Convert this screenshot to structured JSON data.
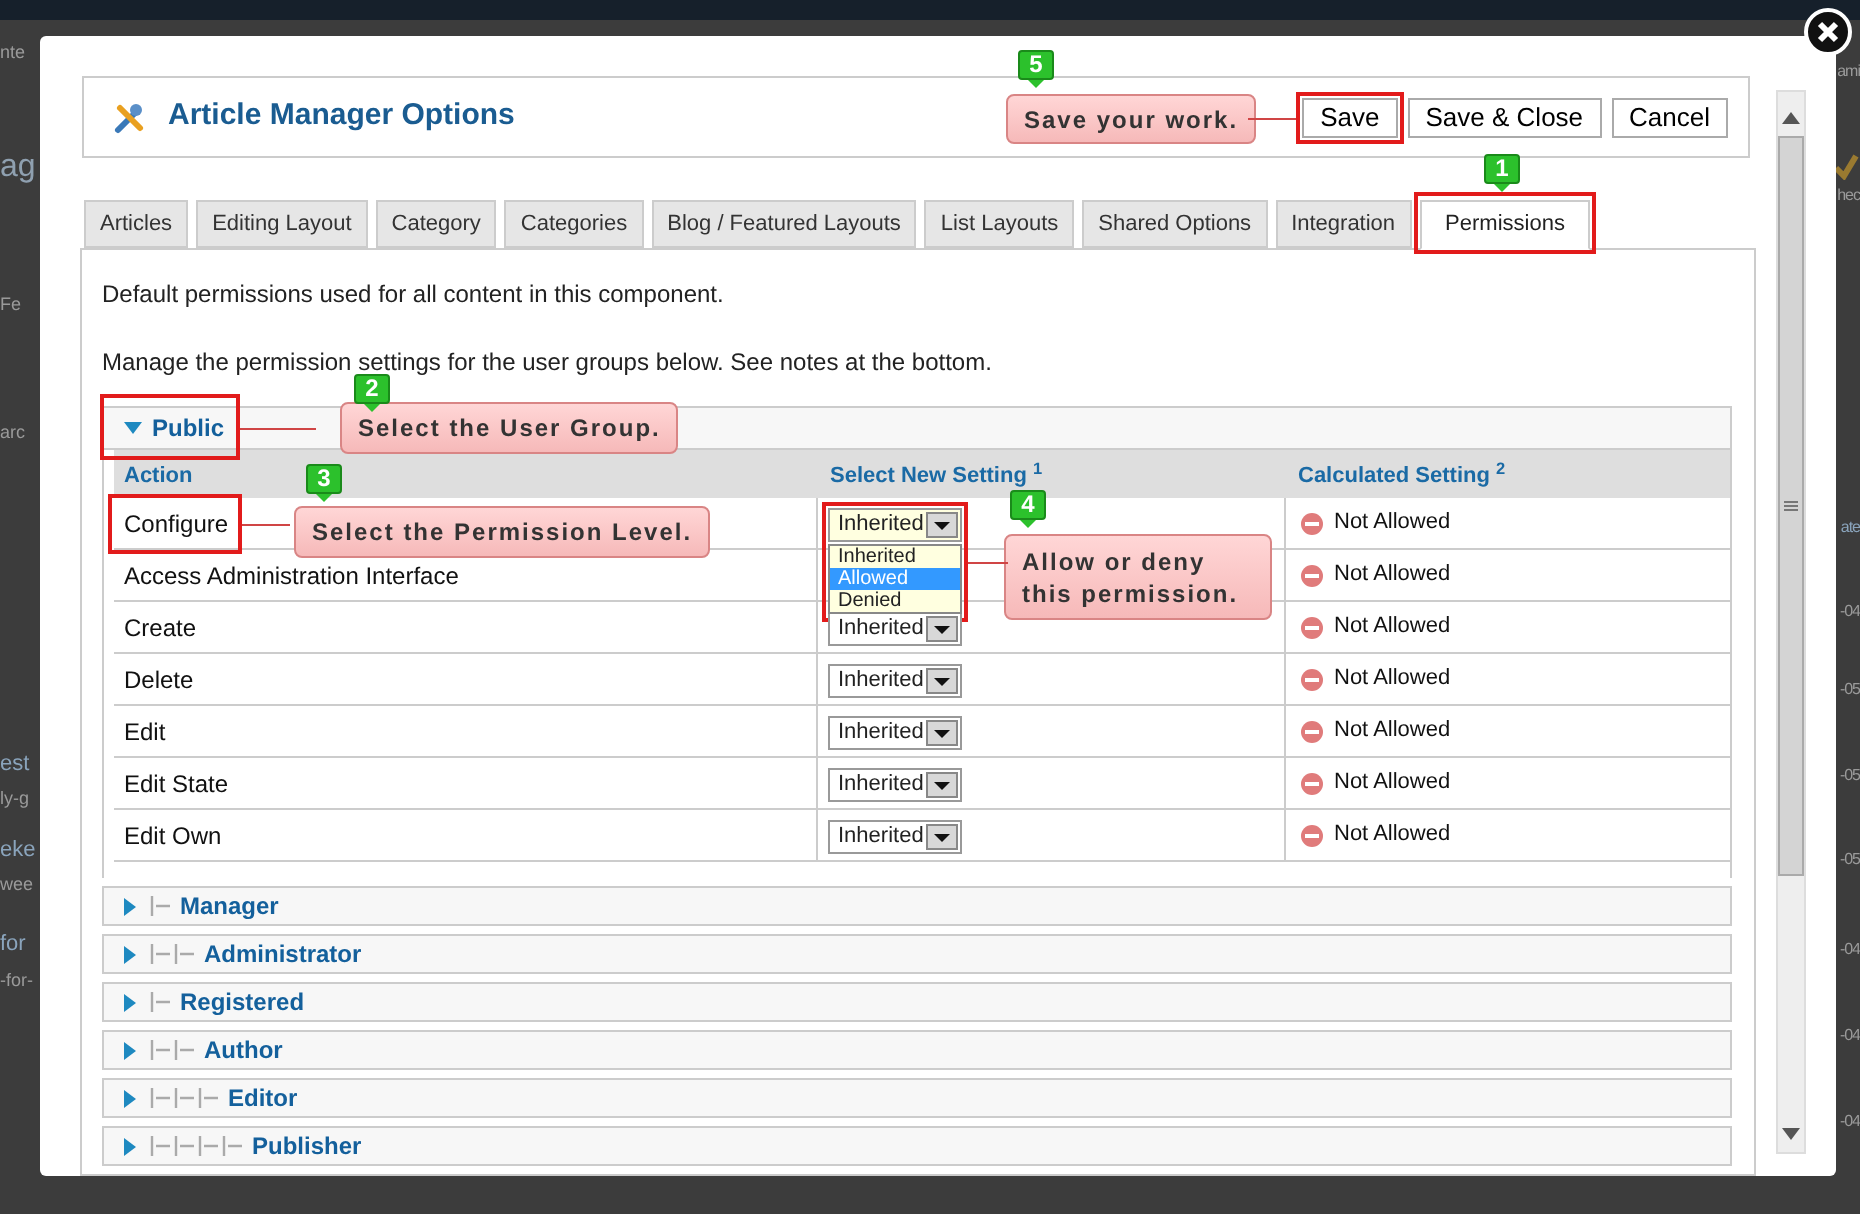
{
  "background_page": {
    "left_fragments": [
      {
        "text": "nte",
        "kind": "small"
      },
      {
        "text": "ag",
        "kind": "large"
      },
      {
        "text": "Fe",
        "kind": "small"
      },
      {
        "text": "arc",
        "kind": "small"
      },
      {
        "text": "est",
        "kind": "link"
      },
      {
        "text": "ly-g",
        "kind": "small"
      },
      {
        "text": "eke",
        "kind": "link"
      },
      {
        "text": "wee",
        "kind": "small"
      },
      {
        "text": "for",
        "kind": "link"
      },
      {
        "text": "-for-",
        "kind": "small"
      }
    ],
    "right_fragments": [
      {
        "text": "ami",
        "kind": "small"
      },
      {
        "text": "hec",
        "kind": "small"
      },
      {
        "text": "ate",
        "kind": "link"
      },
      {
        "text": "-04",
        "kind": "small"
      },
      {
        "text": "-05",
        "kind": "small"
      },
      {
        "text": "-05",
        "kind": "small"
      },
      {
        "text": "-05",
        "kind": "small"
      },
      {
        "text": "-04",
        "kind": "small"
      },
      {
        "text": "-04",
        "kind": "small"
      },
      {
        "text": "-04",
        "kind": "small"
      }
    ]
  },
  "modal": {
    "title": "Article Manager Options",
    "buttons": [
      {
        "label": "Save"
      },
      {
        "label": "Save & Close"
      },
      {
        "label": "Cancel"
      }
    ]
  },
  "tabs": [
    {
      "label": "Articles",
      "selected": false
    },
    {
      "label": "Editing Layout",
      "selected": false
    },
    {
      "label": "Category",
      "selected": false
    },
    {
      "label": "Categories",
      "selected": false
    },
    {
      "label": "Blog / Featured Layouts",
      "selected": false
    },
    {
      "label": "List Layouts",
      "selected": false
    },
    {
      "label": "Shared Options",
      "selected": false
    },
    {
      "label": "Integration",
      "selected": false
    },
    {
      "label": "Permissions",
      "selected": true
    }
  ],
  "intro": [
    "Default permissions used for all content in this component.",
    "Manage the permission settings for the user groups below. See notes at the bottom."
  ],
  "groups": [
    {
      "name": "Public",
      "expanded": true,
      "table": {
        "columns": [
          "Action",
          "Select New Setting $^{1}$",
          "Calculated Setting $^{2}$"
        ],
        "rows": [
          {
            "action": "Configure",
            "setting": "Inherited",
            "calculated": "Not Allowed",
            "options": [
              {
                "label": "Inherited",
                "selected": false
              },
              {
                "label": "Allowed",
                "selected": true
              },
              {
                "label": "Denied",
                "selected": false
              }
            ]
          },
          {
            "action": "Access Administration Interface",
            "calculated": "Not Allowed"
          },
          {
            "action": "Create",
            "setting": "Inherited",
            "calculated": "Not Allowed"
          },
          {
            "action": "Delete",
            "setting": "Inherited",
            "calculated": "Not Allowed"
          },
          {
            "action": "Edit",
            "setting": "Inherited",
            "calculated": "Not Allowed"
          },
          {
            "action": "Edit State",
            "setting": "Inherited",
            "calculated": "Not Allowed"
          },
          {
            "action": "Edit Own",
            "setting": "Inherited",
            "calculated": "Not Allowed"
          }
        ]
      },
      "children": [
        {
          "name": "Manager",
          "expanded": false,
          "children": [
            {
              "name": "Administrator",
              "expanded": false
            }
          ]
        },
        {
          "name": "Registered",
          "expanded": false,
          "children": [
            {
              "name": "Author",
              "expanded": false,
              "children": [
                {
                  "name": "Editor",
                  "expanded": false,
                  "children": [
                    {
                      "name": "Publisher",
                      "expanded": false
                    }
                  ]
                }
              ]
            }
          ]
        }
      ]
    }
  ],
  "annotations": [
    {
      "number": "5",
      "text": "Save your work."
    },
    {
      "number": "1"
    },
    {
      "number": "2",
      "text": "Select the User Group."
    },
    {
      "number": "3",
      "text": "Select the Permission Level."
    },
    {
      "number": "4",
      "text": "Allow or deny this permission."
    }
  ]
}
